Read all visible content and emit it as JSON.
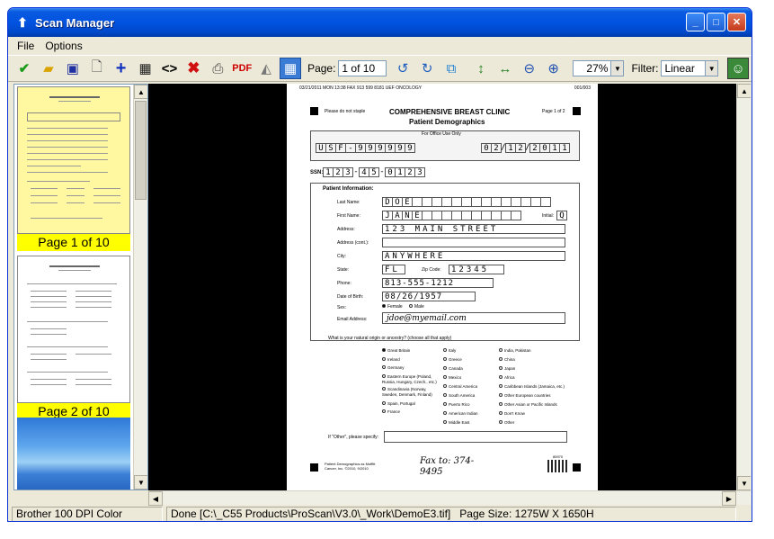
{
  "window": {
    "title": "Scan Manager"
  },
  "menu": [
    "File",
    "Options"
  ],
  "toolbar": {
    "page_label": "Page:",
    "page_value": "1 of 10",
    "zoom_value": "27%",
    "filter_label": "Filter:",
    "filter_value": "Linear"
  },
  "thumbnails": [
    {
      "label": "Page 1 of 10"
    },
    {
      "label": "Page 2 of 10"
    }
  ],
  "document": {
    "fax_header": "03/21/2011 MON 13:38 FAX 913 599 8181 UEF ONCOLOGY",
    "fax_page": "001/003",
    "do_not_staple": "Please do not staple",
    "clinic": "COMPREHENSIVE BREAST CLINIC",
    "subtitle": "Patient Demographics",
    "page_of": "Page 1 of 2",
    "office_use": "For Office Use Only",
    "mrn": [
      "U",
      "S",
      "F",
      "-",
      "9",
      "9",
      "9",
      "9",
      "9",
      "9"
    ],
    "date": [
      "0",
      "2",
      "1",
      "2",
      "2",
      "0",
      "1",
      "1"
    ],
    "ssn_label": "SSN:",
    "ssn": [
      "1",
      "2",
      "3",
      "-",
      "4",
      "5",
      "-",
      "0",
      "1",
      "2",
      "3"
    ],
    "section": "Patient Information:",
    "last_name_label": "Last Name:",
    "last_name": [
      "D",
      "O",
      "E"
    ],
    "first_name_label": "First Name:",
    "first_name": [
      "J",
      "A",
      "N",
      "E"
    ],
    "initial_label": "Initial:",
    "initial": "Q",
    "address_label": "Address:",
    "address": "123 MAIN STREET",
    "address_cont_label": "Address (cont.):",
    "city_label": "City:",
    "city": "ANYWHERE",
    "state_label": "State:",
    "state": "FL",
    "zip_label": "Zip Code:",
    "zip": "12345",
    "phone_label": "Phone:",
    "phone": "813-555-1212",
    "dob_label": "Date of Birth:",
    "dob": "08/26/1957",
    "sex_label": "Sex:",
    "sex_female": "Female",
    "sex_male": "Male",
    "email_label": "Email Address:",
    "email": "jdoe@myemail.com",
    "origin_question": "What is your natural origin or ancestry? (choose all that apply)",
    "origins_col1": [
      "Great Britain",
      "Ireland",
      "Germany",
      "Eastern Europe (Poland, Russia, Hungary, Czech., etc.)",
      "Scandinavia (Norway, Sweden, Denmark, Finland)",
      "Spain, Portugal",
      "France"
    ],
    "origins_col2": [
      "Italy",
      "Greece",
      "Canada",
      "Mexico",
      "Central America",
      "South America",
      "Puerto Rico",
      "American Indian",
      "Middle East"
    ],
    "origins_col3": [
      "India, Pakistan",
      "China",
      "Japan",
      "Africa",
      "Caribbean Islands (Jamaica, etc.)",
      "Other European countries",
      "Other Asian or Pacific Islands",
      "Don't Know",
      "Other"
    ],
    "other_label": "If \"Other\", please specify:",
    "footer_left": "Patient Demographics.ss Moffitt Cancer, Inc. ©2010, 9/2010",
    "handwriting": "Fax to: 374-9495",
    "footer_code": "85970"
  },
  "status": {
    "scanner": "Brother 100 DPI Color",
    "message": "Done  [C:\\_C55 Products\\ProScan\\V3.0\\_Work\\DemoE3.tif]",
    "page_size": "Page Size: 1275W X 1650H"
  },
  "colors": {
    "title_bar": "#0053e1",
    "thumb_label_bg": "#ffff00",
    "thumb_page1_bg": "#fff8a0",
    "viewer_bg": "#000000"
  }
}
